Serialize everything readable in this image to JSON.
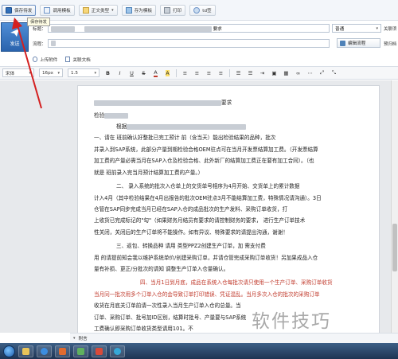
{
  "toolbar": {
    "buttons": [
      {
        "label": "保存待发",
        "icon": "save-icon"
      },
      {
        "label": "调用模板",
        "icon": "template-icon"
      },
      {
        "label": "正文类型",
        "icon": "doc-type-icon"
      },
      {
        "label": "存为模板",
        "icon": "save-as-template-icon"
      },
      {
        "label": "打印",
        "icon": "print-icon"
      },
      {
        "label": "td签",
        "icon": "sign-icon"
      }
    ],
    "tooltip": "保存待发"
  },
  "header": {
    "send_label": "发送",
    "title_label": "标题：",
    "title_value": "要求",
    "flow_label": "流程：",
    "priority_value": "普通",
    "edit_flow_label": "编辑流程",
    "right_label_1": "关联项",
    "right_label_2": "预归档"
  },
  "attachments": {
    "upload_label": "上传附件",
    "related_label": "关联文档"
  },
  "format": {
    "font_family": "宋体",
    "font_size": "16px",
    "line_height": "1.5",
    "bold": "B",
    "italic": "I",
    "underline": "U"
  },
  "document": {
    "lines": [
      {
        "text": "要求",
        "color": "normal"
      },
      {
        "text": "检验",
        "color": "normal"
      },
      {
        "text": "根据",
        "color": "normal"
      },
      {
        "text": "一、请在        班前确认好整批已完工预计        前（含当天）能出检验结果的品种，批次",
        "color": "normal"
      },
      {
        "text": "并录入到SAP系统，此部分产量到期检验合格OEM驻点可在当月开发票结算加工费。（开发票结算",
        "color": "normal"
      },
      {
        "text": "加工费的产量必需当月在SAP入仓及检验合格、此外新厂的结算加工费正在要有加工合同）。（也",
        "color": "normal"
      },
      {
        "text": "就是        班前录入完当月预计结算加工费的产量。）",
        "color": "normal"
      },
      {
        "text": "二、        录入系统的批次入仓单上的交货单号相序为4月开始、交货单上的累计数据",
        "color": "normal"
      },
      {
        "text": "计入4月（其中检验结果在4月出报告的批次OEM驻点3月不能结算加工费，特殊情况请沟通）。3日",
        "color": "normal"
      },
      {
        "text": "        仓管在SAP同步完成当月已经在SAP入仓的成品批次的生产发料、采购订单收货，打",
        "color": "normal"
      },
      {
        "text": "上收货已完成标记的\"勾\"（如果财务月结员有要求的请控制财务的要求，        进行生产订单技术",
        "color": "normal"
      },
      {
        "text": "性关闭，关闭后的生产订单将不能操作。如有异议、特殊要求的请提出沟通，谢谢！",
        "color": "normal"
      },
      {
        "text": "三、返包、转换品种        请用        类型PPZ2创建生产订单，加  需支付费",
        "color": "normal"
      },
      {
        "text": "用  的请提前知会我以维护系统单价/创建采购订单，并请仓管完成采购订单收货！另加果成品入仓",
        "color": "normal"
      },
      {
        "text": "量有补损、更正/分批次的请知        调整生产订单入仓量确认。",
        "color": "normal"
      },
      {
        "text": "四、当月1日到月底，成品在系统入仓每批次请只使用一个生产订单、采购订单收货",
        "color": "red"
      },
      {
        "text": "当月同一批次用多个订单入仓的会导致订单打印错误、凭证混乱。当月多次入仓的批次的采购订单",
        "color": "red"
      },
      {
        "text": "收货在月底关订单前请一次性录入当月生产订单入仓的总量。当",
        "color": "normal"
      },
      {
        "text": "订单、采购订单、批号加ID区别，结算时批号、产量要与SAP系统",
        "color": "normal"
      },
      {
        "text": "工费确认即采购订单收货类型请用101。不",
        "color": "normal"
      }
    ]
  },
  "footer": {
    "attachment_label": "附言"
  },
  "watermark": "软件技巧"
}
